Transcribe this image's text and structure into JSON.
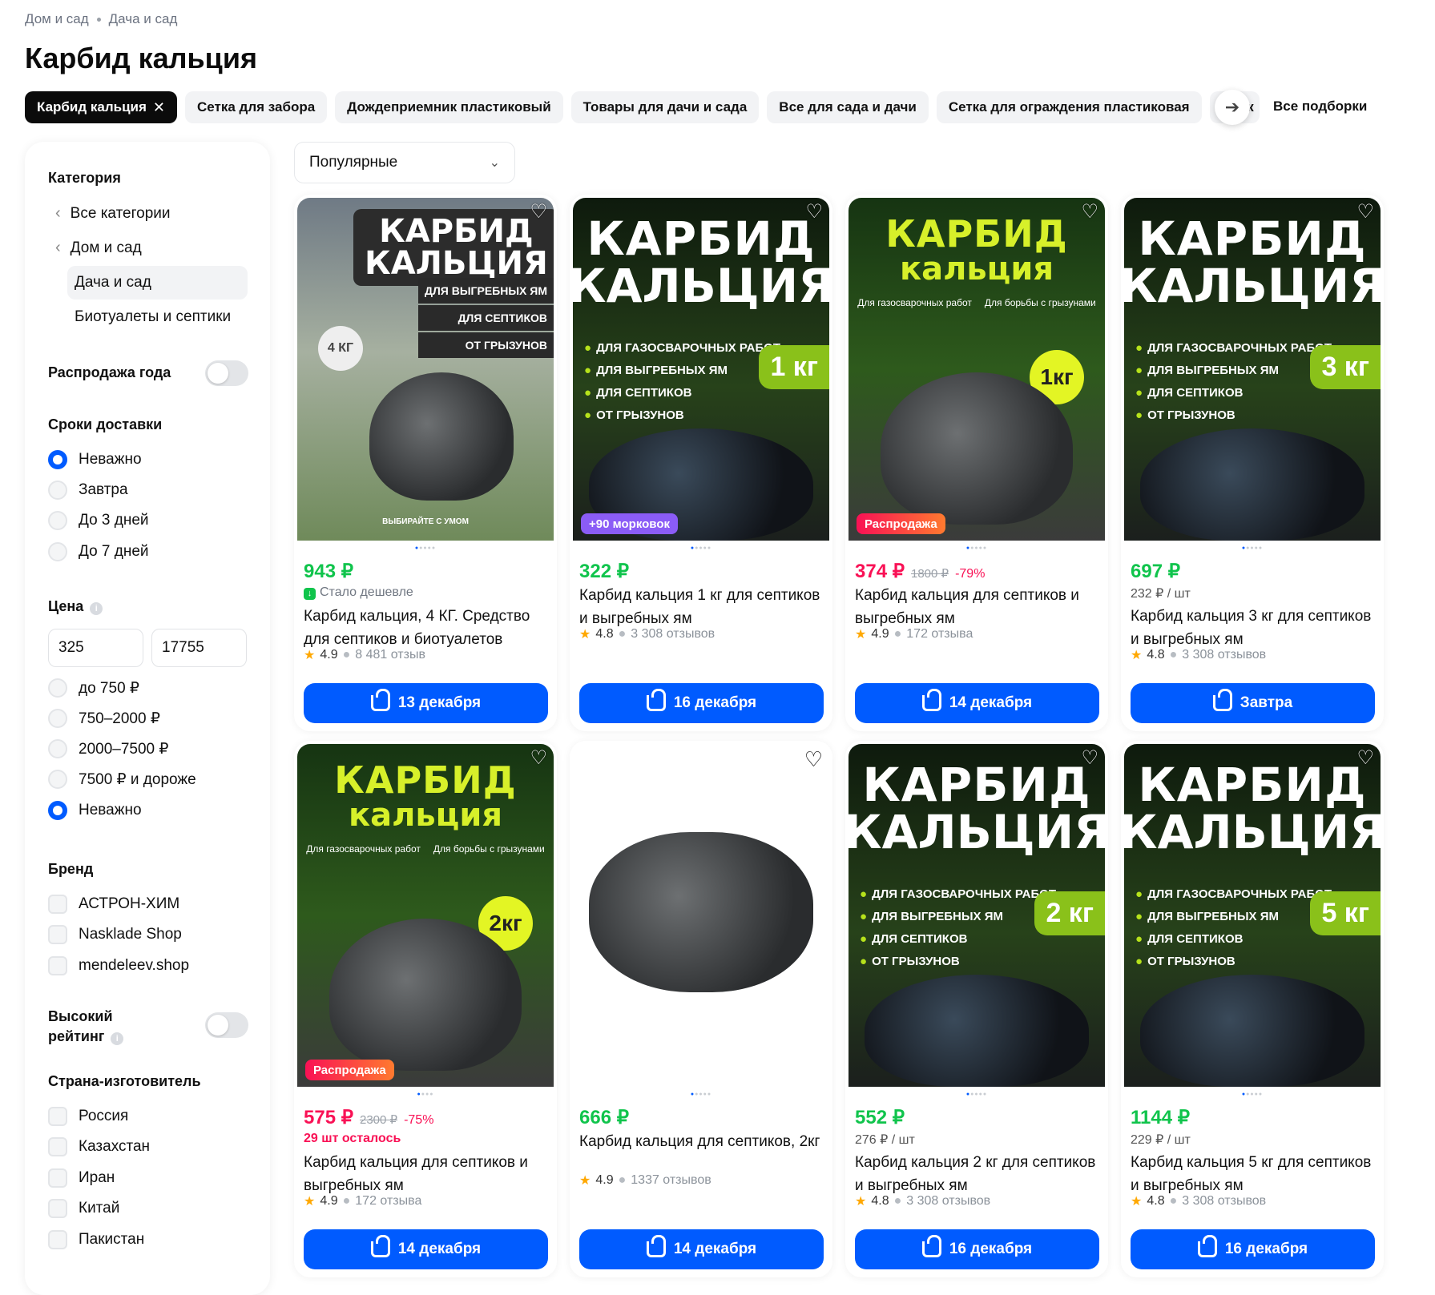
{
  "breadcrumb": [
    "Дом и сад",
    "Дача и сад"
  ],
  "page_title": "Карбид кальция",
  "chips": [
    {
      "label": "Карбид кальция",
      "active": true
    },
    {
      "label": "Сетка для забора"
    },
    {
      "label": "Дождеприемник пластиковый"
    },
    {
      "label": "Товары для дачи и сада"
    },
    {
      "label": "Все для сада и дачи"
    },
    {
      "label": "Сетка для ограждения пластиковая"
    },
    {
      "label": "Элек"
    }
  ],
  "all_selections": "Все подборки",
  "sort": {
    "value": "Популярные"
  },
  "sidebar": {
    "category_title": "Категория",
    "categories": [
      "Все категории",
      "Дом и сад",
      "Дача и сад",
      "Биотуалеты и септики"
    ],
    "sale_label": "Распродажа года",
    "delivery_title": "Сроки доставки",
    "delivery_options": [
      "Неважно",
      "Завтра",
      "До 3 дней",
      "До 7 дней"
    ],
    "price_title": "Цена",
    "price_from": "325",
    "price_to": "17755",
    "price_options": [
      "до 750 ₽",
      "750–2000 ₽",
      "2000–7500 ₽",
      "7500 ₽ и дороже",
      "Неважно"
    ],
    "brand_title": "Бренд",
    "brands": [
      "АСТРОН-ХИМ",
      "Nasklade Shop",
      "mendeleev.shop"
    ],
    "rating_label_1": "Высокий",
    "rating_label_2": "рейтинг",
    "country_title": "Страна-изготовитель",
    "countries": [
      "Россия",
      "Казахстан",
      "Иран",
      "Китай",
      "Пакистан"
    ]
  },
  "products": [
    {
      "img_t1": "КАРБИД",
      "img_t2": "КАЛЬЦИЯ",
      "tag1": "ДЛЯ ВЫГРЕБНЫХ ЯМ",
      "tag2": "ДЛЯ СЕПТИКОВ",
      "tag3": "ОТ ГРЫЗУНОВ",
      "circle": "4 КГ",
      "foot": "ВЫБИРАЙТЕ С УМОМ",
      "price": "943 ₽",
      "sub": "Стало дешевле",
      "title": "Карбид кальция, 4 КГ. Средство для септиков и биотуалетов",
      "rating": "4.9",
      "reviews": "8 481 отзыв",
      "delivery": "13 декабря"
    },
    {
      "img_t1": "КАРБИД",
      "img_t2": "КАЛЬЦИЯ",
      "l1": "ДЛЯ ГАЗОСВАРОЧНЫХ РАБОТ",
      "l2": "ДЛЯ ВЫГРЕБНЫХ ЯМ",
      "l3": "ДЛЯ СЕПТИКОВ",
      "l4": "ОТ ГРЫЗУНОВ",
      "kg": "1 кг",
      "badge": "+90 морковок",
      "price": "322 ₽",
      "title": "Карбид кальция 1 кг для септиков и выгребных ям",
      "rating": "4.8",
      "reviews": "3 308 отзывов",
      "delivery": "16 декабря"
    },
    {
      "img_t1": "КАРБИД",
      "img_t2": "кальция",
      "s1": "Для газосварочных работ",
      "s2": "Для борьбы с грызунами",
      "kg": "1кг",
      "badge": "Распродажа",
      "price": "374 ₽",
      "old": "1800 ₽",
      "pct": "-79%",
      "title": "Карбид кальция для септиков и выгребных ям",
      "rating": "4.9",
      "reviews": "172 отзыва",
      "delivery": "14 декабря"
    },
    {
      "img_t1": "КАРБИД",
      "img_t2": "КАЛЬЦИЯ",
      "l1": "ДЛЯ ГАЗОСВАРОЧНЫХ РАБОТ",
      "l2": "ДЛЯ ВЫГРЕБНЫХ ЯМ",
      "l3": "ДЛЯ СЕПТИКОВ",
      "l4": "ОТ ГРЫЗУНОВ",
      "kg": "3 кг",
      "price": "697 ₽",
      "sub": "232 ₽ / шт",
      "title": "Карбид кальция 3 кг для септиков и выгребных ям",
      "rating": "4.8",
      "reviews": "3 308 отзывов",
      "delivery": "Завтра"
    },
    {
      "img_t1": "КАРБИД",
      "img_t2": "кальция",
      "s1": "Для газосварочных работ",
      "s2": "Для борьбы с грызунами",
      "kg": "2кг",
      "badge": "Распродажа",
      "price": "575 ₽",
      "old": "2300 ₽",
      "pct": "-75%",
      "sub": "29 шт осталось",
      "title": "Карбид кальция для септиков и выгребных ям",
      "rating": "4.9",
      "reviews": "172 отзыва",
      "delivery": "14 декабря"
    },
    {
      "price": "666 ₽",
      "title": "Карбид кальция для септиков, 2кг",
      "rating": "4.9",
      "reviews": "1337 отзывов",
      "delivery": "14 декабря"
    },
    {
      "img_t1": "КАРБИД",
      "img_t2": "КАЛЬЦИЯ",
      "l1": "ДЛЯ ГАЗОСВАРОЧНЫХ РАБОТ",
      "l2": "ДЛЯ ВЫГРЕБНЫХ ЯМ",
      "l3": "ДЛЯ СЕПТИКОВ",
      "l4": "ОТ ГРЫЗУНОВ",
      "kg": "2 кг",
      "price": "552 ₽",
      "sub": "276 ₽ / шт",
      "title": "Карбид кальция 2 кг для септиков и выгребных ям",
      "rating": "4.8",
      "reviews": "3 308 отзывов",
      "delivery": "16 декабря"
    },
    {
      "img_t1": "КАРБИД",
      "img_t2": "КАЛЬЦИЯ",
      "l1": "ДЛЯ ГАЗОСВАРОЧНЫХ РАБОТ",
      "l2": "ДЛЯ ВЫГРЕБНЫХ ЯМ",
      "l3": "ДЛЯ СЕПТИКОВ",
      "l4": "ОТ ГРЫЗУНОВ",
      "kg": "5 кг",
      "price": "1144 ₽",
      "sub": "229 ₽ / шт",
      "title": "Карбид кальция 5 кг для септиков и выгребных ям",
      "rating": "4.8",
      "reviews": "3 308 отзывов",
      "delivery": "16 декабря"
    }
  ],
  "colors": {
    "accent": "#005bff",
    "price_green": "#10c44c",
    "sale_red": "#f91155",
    "star": "#ffa800"
  }
}
